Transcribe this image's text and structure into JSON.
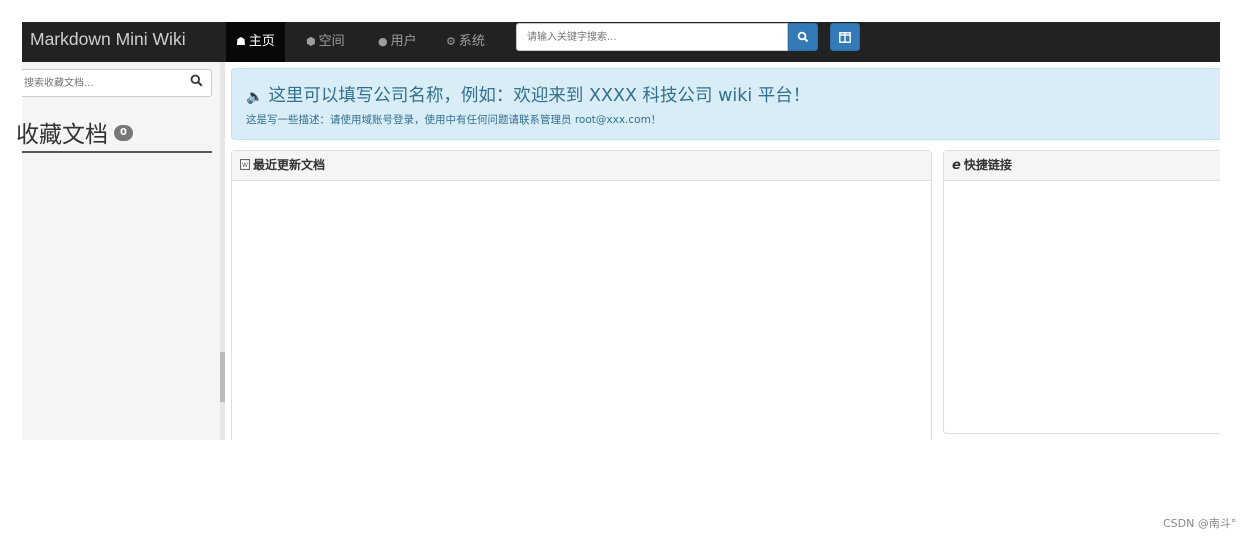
{
  "navbar": {
    "brand": "Markdown Mini Wiki",
    "items": [
      {
        "icon": "home-icon",
        "label": "主页",
        "active": true
      },
      {
        "icon": "cube-icon",
        "label": "空间",
        "active": false
      },
      {
        "icon": "user-icon",
        "label": "用户",
        "active": false
      },
      {
        "icon": "gear-icon",
        "label": "系统",
        "active": false
      }
    ],
    "search_placeholder": "请输入关键字搜索...",
    "search_button_icon": "search-icon",
    "toggle_button_icon": "columns-icon",
    "accent_color": "#337ab7"
  },
  "sidebar": {
    "search_placeholder": "搜索收藏文档...",
    "title": "收藏文档",
    "badge_count": "0"
  },
  "alert": {
    "icon": "volume-icon",
    "title": "这里可以填写公司名称，例如：欢迎来到 XXXX 科技公司 wiki 平台！",
    "description": "这是写一些描述：请使用域账号登录，使用中有任何问题请联系管理员 root@xxx.com！",
    "background_color": "#d9edf7"
  },
  "panels": {
    "recent": {
      "icon": "word-document-icon",
      "title": "最近更新文档"
    },
    "links": {
      "icon": "internet-explorer-icon",
      "title": "快捷链接"
    }
  },
  "watermark": "CSDN @南斗°"
}
